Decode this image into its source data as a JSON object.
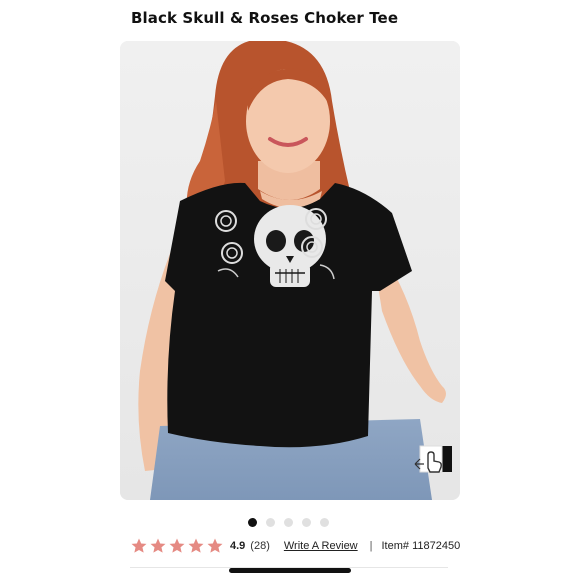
{
  "product": {
    "title": "Black Skull & Roses Choker Tee",
    "item_label": "Item# 11872450"
  },
  "rating": {
    "score": "4.9",
    "count": "(28)",
    "stars": 5,
    "star_color": "#e58a83",
    "write_review": "Write A Review",
    "separator": "|"
  },
  "gallery": {
    "total_images": 5,
    "active_index": 0
  },
  "icons": {
    "zoom": "hand-pointer-zoom-icon",
    "star": "star-icon"
  }
}
